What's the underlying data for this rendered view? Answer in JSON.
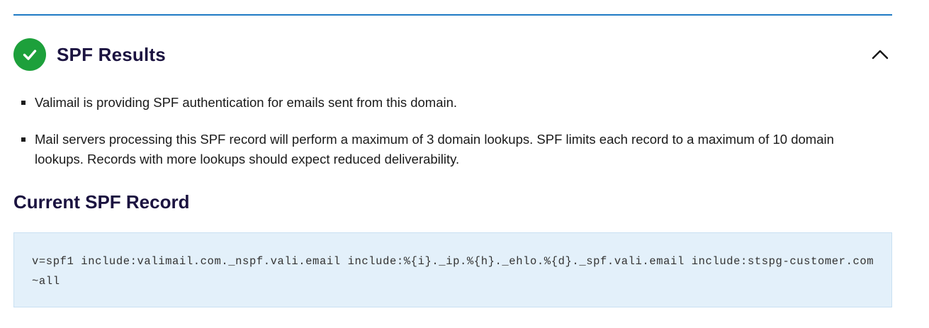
{
  "spf_results": {
    "title": "SPF Results",
    "status_icon": "check-icon",
    "toggle_icon": "chevron-up-icon",
    "bullets": [
      "Valimail is providing SPF authentication for emails sent from this domain.",
      "Mail servers processing this SPF record will perform a maximum of 3 domain lookups. SPF limits each record to a maximum of 10 domain lookups. Records with more lookups should expect reduced deliverability."
    ]
  },
  "current_record": {
    "heading": "Current SPF Record",
    "value": "v=spf1 include:valimail.com._nspf.vali.email include:%{i}._ip.%{h}._ehlo.%{d}._spf.vali.email include:stspg-customer.com ~all"
  },
  "colors": {
    "accent_rule": "#1f7ac4",
    "success": "#1da03b",
    "heading": "#1b1340",
    "record_background": "#e3f0fa"
  }
}
